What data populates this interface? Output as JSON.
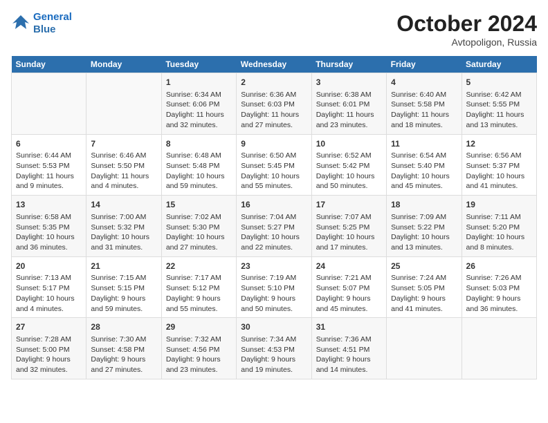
{
  "header": {
    "logo_line1": "General",
    "logo_line2": "Blue",
    "month": "October 2024",
    "location": "Avtopoligon, Russia"
  },
  "days_of_week": [
    "Sunday",
    "Monday",
    "Tuesday",
    "Wednesday",
    "Thursday",
    "Friday",
    "Saturday"
  ],
  "weeks": [
    [
      {
        "num": "",
        "info": ""
      },
      {
        "num": "",
        "info": ""
      },
      {
        "num": "1",
        "info": "Sunrise: 6:34 AM\nSunset: 6:06 PM\nDaylight: 11 hours\nand 32 minutes."
      },
      {
        "num": "2",
        "info": "Sunrise: 6:36 AM\nSunset: 6:03 PM\nDaylight: 11 hours\nand 27 minutes."
      },
      {
        "num": "3",
        "info": "Sunrise: 6:38 AM\nSunset: 6:01 PM\nDaylight: 11 hours\nand 23 minutes."
      },
      {
        "num": "4",
        "info": "Sunrise: 6:40 AM\nSunset: 5:58 PM\nDaylight: 11 hours\nand 18 minutes."
      },
      {
        "num": "5",
        "info": "Sunrise: 6:42 AM\nSunset: 5:55 PM\nDaylight: 11 hours\nand 13 minutes."
      }
    ],
    [
      {
        "num": "6",
        "info": "Sunrise: 6:44 AM\nSunset: 5:53 PM\nDaylight: 11 hours\nand 9 minutes."
      },
      {
        "num": "7",
        "info": "Sunrise: 6:46 AM\nSunset: 5:50 PM\nDaylight: 11 hours\nand 4 minutes."
      },
      {
        "num": "8",
        "info": "Sunrise: 6:48 AM\nSunset: 5:48 PM\nDaylight: 10 hours\nand 59 minutes."
      },
      {
        "num": "9",
        "info": "Sunrise: 6:50 AM\nSunset: 5:45 PM\nDaylight: 10 hours\nand 55 minutes."
      },
      {
        "num": "10",
        "info": "Sunrise: 6:52 AM\nSunset: 5:42 PM\nDaylight: 10 hours\nand 50 minutes."
      },
      {
        "num": "11",
        "info": "Sunrise: 6:54 AM\nSunset: 5:40 PM\nDaylight: 10 hours\nand 45 minutes."
      },
      {
        "num": "12",
        "info": "Sunrise: 6:56 AM\nSunset: 5:37 PM\nDaylight: 10 hours\nand 41 minutes."
      }
    ],
    [
      {
        "num": "13",
        "info": "Sunrise: 6:58 AM\nSunset: 5:35 PM\nDaylight: 10 hours\nand 36 minutes."
      },
      {
        "num": "14",
        "info": "Sunrise: 7:00 AM\nSunset: 5:32 PM\nDaylight: 10 hours\nand 31 minutes."
      },
      {
        "num": "15",
        "info": "Sunrise: 7:02 AM\nSunset: 5:30 PM\nDaylight: 10 hours\nand 27 minutes."
      },
      {
        "num": "16",
        "info": "Sunrise: 7:04 AM\nSunset: 5:27 PM\nDaylight: 10 hours\nand 22 minutes."
      },
      {
        "num": "17",
        "info": "Sunrise: 7:07 AM\nSunset: 5:25 PM\nDaylight: 10 hours\nand 17 minutes."
      },
      {
        "num": "18",
        "info": "Sunrise: 7:09 AM\nSunset: 5:22 PM\nDaylight: 10 hours\nand 13 minutes."
      },
      {
        "num": "19",
        "info": "Sunrise: 7:11 AM\nSunset: 5:20 PM\nDaylight: 10 hours\nand 8 minutes."
      }
    ],
    [
      {
        "num": "20",
        "info": "Sunrise: 7:13 AM\nSunset: 5:17 PM\nDaylight: 10 hours\nand 4 minutes."
      },
      {
        "num": "21",
        "info": "Sunrise: 7:15 AM\nSunset: 5:15 PM\nDaylight: 9 hours\nand 59 minutes."
      },
      {
        "num": "22",
        "info": "Sunrise: 7:17 AM\nSunset: 5:12 PM\nDaylight: 9 hours\nand 55 minutes."
      },
      {
        "num": "23",
        "info": "Sunrise: 7:19 AM\nSunset: 5:10 PM\nDaylight: 9 hours\nand 50 minutes."
      },
      {
        "num": "24",
        "info": "Sunrise: 7:21 AM\nSunset: 5:07 PM\nDaylight: 9 hours\nand 45 minutes."
      },
      {
        "num": "25",
        "info": "Sunrise: 7:24 AM\nSunset: 5:05 PM\nDaylight: 9 hours\nand 41 minutes."
      },
      {
        "num": "26",
        "info": "Sunrise: 7:26 AM\nSunset: 5:03 PM\nDaylight: 9 hours\nand 36 minutes."
      }
    ],
    [
      {
        "num": "27",
        "info": "Sunrise: 7:28 AM\nSunset: 5:00 PM\nDaylight: 9 hours\nand 32 minutes."
      },
      {
        "num": "28",
        "info": "Sunrise: 7:30 AM\nSunset: 4:58 PM\nDaylight: 9 hours\nand 27 minutes."
      },
      {
        "num": "29",
        "info": "Sunrise: 7:32 AM\nSunset: 4:56 PM\nDaylight: 9 hours\nand 23 minutes."
      },
      {
        "num": "30",
        "info": "Sunrise: 7:34 AM\nSunset: 4:53 PM\nDaylight: 9 hours\nand 19 minutes."
      },
      {
        "num": "31",
        "info": "Sunrise: 7:36 AM\nSunset: 4:51 PM\nDaylight: 9 hours\nand 14 minutes."
      },
      {
        "num": "",
        "info": ""
      },
      {
        "num": "",
        "info": ""
      }
    ]
  ]
}
